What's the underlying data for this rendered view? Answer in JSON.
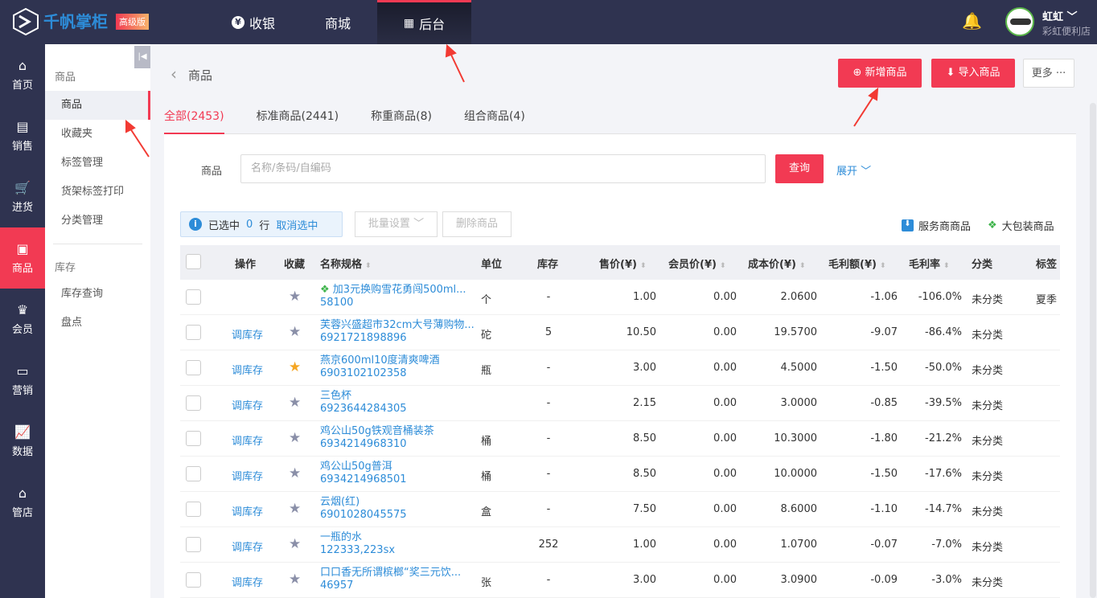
{
  "app": {
    "name": "千帆掌柜",
    "edition": "高级版"
  },
  "topnav": [
    {
      "label": "收银",
      "icon": "yen-icon"
    },
    {
      "label": "商城"
    },
    {
      "label": "后台",
      "icon": "grid-icon",
      "active": true
    }
  ],
  "user": {
    "name": "虹虹",
    "store": "彩虹便利店"
  },
  "leftnav": [
    {
      "label": "首页",
      "icon": "home-icon"
    },
    {
      "label": "销售",
      "icon": "receipt-icon"
    },
    {
      "label": "进货",
      "icon": "cart-icon"
    },
    {
      "label": "商品",
      "icon": "bag-icon",
      "active": true
    },
    {
      "label": "会员",
      "icon": "crown-icon"
    },
    {
      "label": "营销",
      "icon": "ticket-icon"
    },
    {
      "label": "数据",
      "icon": "chart-icon"
    },
    {
      "label": "管店",
      "icon": "shop-icon"
    }
  ],
  "sidebar": {
    "group1": "商品",
    "items1": [
      "商品",
      "收藏夹",
      "标签管理",
      "货架标签打印",
      "分类管理"
    ],
    "group2": "库存",
    "items2": [
      "库存查询",
      "盘点"
    ]
  },
  "header": {
    "title": "商品",
    "add": "新增商品",
    "import": "导入商品",
    "more": "更多 ···"
  },
  "tabs": [
    "全部(2453)",
    "标准商品(2441)",
    "称重商品(8)",
    "组合商品(4)"
  ],
  "filter": {
    "label": "商品",
    "placeholder": "名称/条码/自编码",
    "query": "查询",
    "expand": "展开"
  },
  "selection": {
    "prefix": "已选中",
    "count": "0",
    "suffix": "行",
    "cancel": "取消选中",
    "batch": "批量设置",
    "delete": "删除商品"
  },
  "legend": {
    "service": "服务商商品",
    "bulk": "大包装商品"
  },
  "columns": [
    "操作",
    "收藏",
    "名称规格",
    "单位",
    "库存",
    "售价(¥)",
    "会员价(¥)",
    "成本价(¥)",
    "毛利额(¥)",
    "毛利率",
    "分类",
    "标签"
  ],
  "rows": [
    {
      "op": "",
      "fav": false,
      "bulk": true,
      "name": "加3元换购雪花勇闯500ml...",
      "code": "58100",
      "unit": "个",
      "stock": "-",
      "price": "1.00",
      "member": "0.00",
      "cost": "2.0600",
      "gross": "-1.06",
      "rate": "-106.0%",
      "cat": "未分类",
      "tag": "夏季"
    },
    {
      "op": "调库存",
      "fav": false,
      "name": "芙蓉兴盛超市32cm大号薄购物...",
      "code": "6921721898896",
      "unit": "砣",
      "stock": "5",
      "price": "10.50",
      "member": "0.00",
      "cost": "19.5700",
      "gross": "-9.07",
      "rate": "-86.4%",
      "cat": "未分类",
      "tag": ""
    },
    {
      "op": "调库存",
      "fav": true,
      "name": "燕京600ml10度清爽啤酒",
      "code": "6903102102358",
      "unit": "瓶",
      "stock": "-",
      "price": "3.00",
      "member": "0.00",
      "cost": "4.5000",
      "gross": "-1.50",
      "rate": "-50.0%",
      "cat": "未分类",
      "tag": ""
    },
    {
      "op": "调库存",
      "fav": false,
      "name": "三色杯",
      "code": "6923644284305",
      "unit": "",
      "stock": "-",
      "price": "2.15",
      "member": "0.00",
      "cost": "3.0000",
      "gross": "-0.85",
      "rate": "-39.5%",
      "cat": "未分类",
      "tag": ""
    },
    {
      "op": "调库存",
      "fav": false,
      "name": "鸡公山50g铁观音桶装茶",
      "code": "6934214968310",
      "unit": "桶",
      "stock": "-",
      "price": "8.50",
      "member": "0.00",
      "cost": "10.3000",
      "gross": "-1.80",
      "rate": "-21.2%",
      "cat": "未分类",
      "tag": ""
    },
    {
      "op": "调库存",
      "fav": false,
      "name": "鸡公山50g普洱",
      "code": "6934214968501",
      "unit": "桶",
      "stock": "-",
      "price": "8.50",
      "member": "0.00",
      "cost": "10.0000",
      "gross": "-1.50",
      "rate": "-17.6%",
      "cat": "未分类",
      "tag": ""
    },
    {
      "op": "调库存",
      "fav": false,
      "name": "云烟(红)",
      "code": "6901028045575",
      "unit": "盒",
      "stock": "-",
      "price": "7.50",
      "member": "0.00",
      "cost": "8.6000",
      "gross": "-1.10",
      "rate": "-14.7%",
      "cat": "未分类",
      "tag": ""
    },
    {
      "op": "调库存",
      "fav": false,
      "name": "一瓶的水",
      "code": "122333,223sx",
      "unit": "",
      "stock": "252",
      "price": "1.00",
      "member": "0.00",
      "cost": "1.0700",
      "gross": "-0.07",
      "rate": "-7.0%",
      "cat": "未分类",
      "tag": ""
    },
    {
      "op": "调库存",
      "fav": false,
      "name": "口口香无所谓槟榔“奖三元饮...",
      "code": "46957",
      "unit": "张",
      "stock": "-",
      "price": "3.00",
      "member": "0.00",
      "cost": "3.0900",
      "gross": "-0.09",
      "rate": "-3.0%",
      "cat": "未分类",
      "tag": ""
    }
  ]
}
